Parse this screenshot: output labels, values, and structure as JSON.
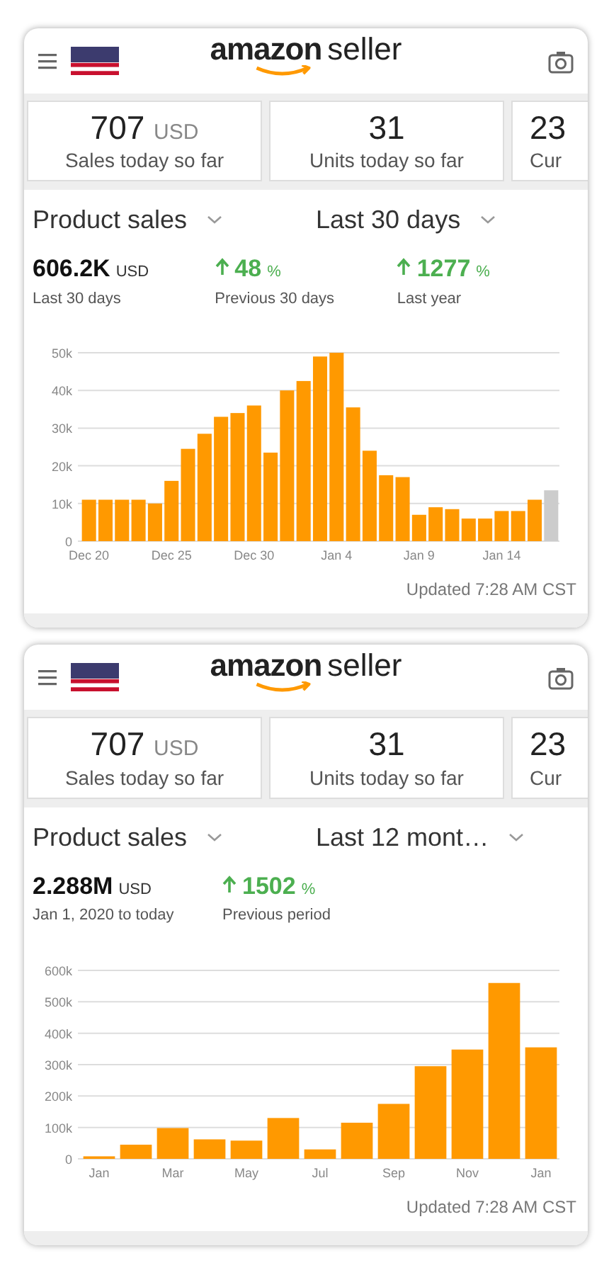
{
  "screens": [
    {
      "logo": {
        "brand": "amazon",
        "product": "seller"
      },
      "tiles": [
        {
          "value": "707",
          "unit": "USD",
          "label": "Sales today so far"
        },
        {
          "value": "31",
          "label": "Units today so far"
        },
        {
          "value": "23",
          "label": "Cur"
        }
      ],
      "selectors": [
        {
          "label": "Product sales"
        },
        {
          "label": "Last 30 days"
        }
      ],
      "stats": [
        {
          "kind": "total",
          "value": "606.2K",
          "unit": "USD",
          "label": "Last 30 days"
        },
        {
          "kind": "change",
          "value": "48",
          "unit": "%",
          "label": "Previous 30 days"
        },
        {
          "kind": "change",
          "value": "1277",
          "unit": "%",
          "label": "Last year"
        }
      ],
      "chart_data": {
        "type": "bar",
        "stacked": true,
        "grid": true,
        "ylim": [
          0,
          50
        ],
        "categories": [
          "Dec 20",
          null,
          null,
          null,
          null,
          "Dec 25",
          null,
          null,
          null,
          null,
          "Dec 30",
          null,
          null,
          null,
          null,
          "Jan 4",
          null,
          null,
          null,
          null,
          "Jan 9",
          null,
          null,
          null,
          null,
          "Jan 14",
          null,
          null,
          null
        ],
        "yticks": [
          0,
          {
            "value": 10,
            "label": "10k"
          },
          {
            "value": 20,
            "label": "20k"
          },
          {
            "value": 30,
            "label": "30k"
          },
          {
            "value": 40,
            "label": "40k"
          },
          {
            "value": 50,
            "label": "50k"
          }
        ],
        "series": [
          {
            "color": "#ff9900",
            "values": [
              11,
              11,
              11,
              11,
              10,
              16,
              24.5,
              28.5,
              33,
              34,
              36,
              23.5,
              40,
              42.5,
              49,
              50,
              35.5,
              24,
              17.5,
              17,
              7,
              9,
              8.5,
              6,
              6,
              8,
              8,
              11,
              null
            ]
          },
          {
            "color": "#cccccc",
            "values": [
              null,
              null,
              null,
              null,
              null,
              null,
              null,
              null,
              null,
              null,
              null,
              null,
              null,
              null,
              null,
              null,
              null,
              null,
              null,
              null,
              null,
              null,
              null,
              null,
              null,
              null,
              null,
              null,
              13.5
            ]
          }
        ]
      },
      "updated": "Updated 7:28 AM CST"
    },
    {
      "logo": {
        "brand": "amazon",
        "product": "seller"
      },
      "tiles": [
        {
          "value": "707",
          "unit": "USD",
          "label": "Sales today so far"
        },
        {
          "value": "31",
          "label": "Units today so far"
        },
        {
          "value": "23",
          "label": "Cur"
        }
      ],
      "selectors": [
        {
          "label": "Product sales"
        },
        {
          "label": "Last 12 mont…"
        }
      ],
      "stats": [
        {
          "kind": "total",
          "value": "2.288M",
          "unit": "USD",
          "label": "Jan 1, 2020 to today"
        },
        {
          "kind": "change",
          "value": "1502",
          "unit": "%",
          "label": "Previous period"
        }
      ],
      "chart_data": {
        "type": "bar",
        "grid": true,
        "ylim": [
          0,
          600
        ],
        "categories": [
          "Jan",
          null,
          "Mar",
          null,
          "May",
          null,
          "Jul",
          null,
          "Sep",
          null,
          "Nov",
          null,
          "Jan"
        ],
        "yticks": [
          0,
          {
            "value": 100,
            "label": "100k"
          },
          {
            "value": 200,
            "label": "200k"
          },
          {
            "value": 300,
            "label": "300k"
          },
          {
            "value": 400,
            "label": "400k"
          },
          {
            "value": 500,
            "label": "500k"
          },
          {
            "value": 600,
            "label": "600k"
          }
        ],
        "series": [
          {
            "color": "#ff9900",
            "values": [
              8,
              45,
              98,
              62,
              58,
              130,
              30,
              115,
              175,
              295,
              348,
              560,
              355
            ]
          }
        ]
      },
      "updated": "Updated 7:28 AM CST"
    }
  ]
}
